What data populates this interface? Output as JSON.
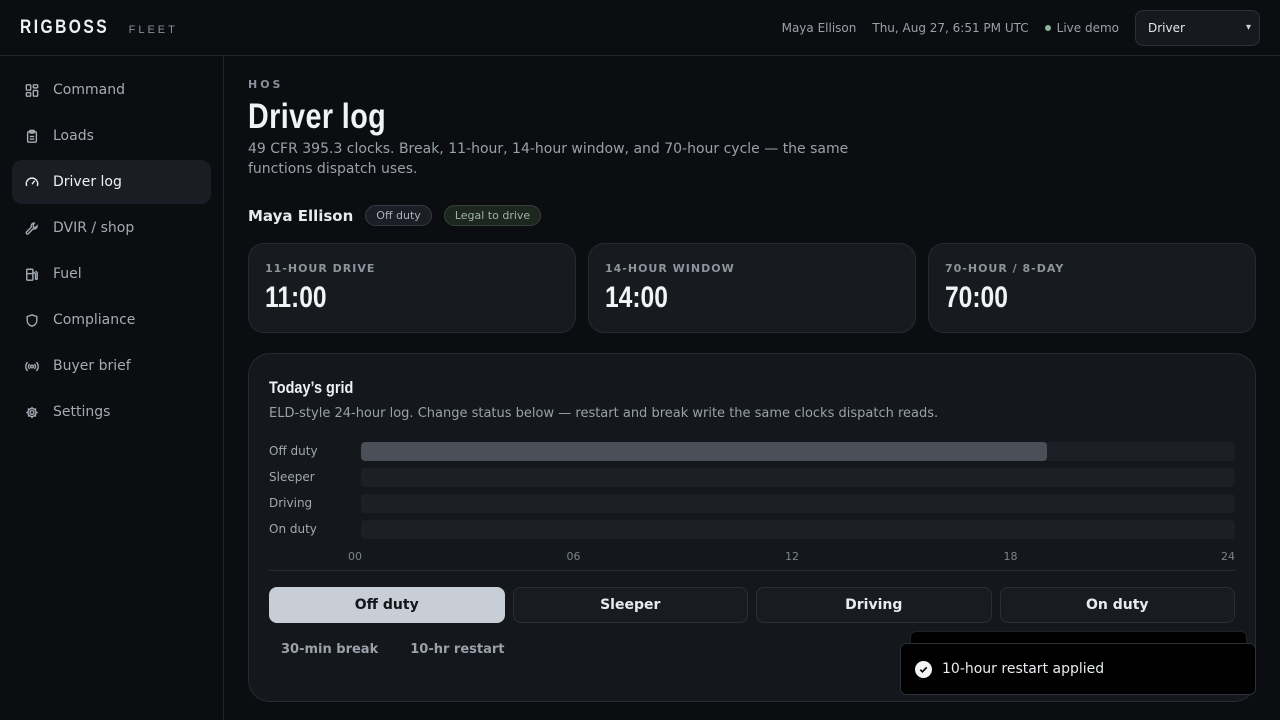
{
  "brand": {
    "name": "RIGBOSS",
    "sub": "FLEET"
  },
  "header": {
    "user": "Maya Ellison",
    "datetime": "Thu, Aug 27, 6:51 PM UTC",
    "live_label": "Live demo",
    "role_value": "Driver",
    "live_color": "#8fb39a"
  },
  "sidebar": {
    "items": [
      {
        "label": "Command",
        "icon": "dashboard-icon"
      },
      {
        "label": "Loads",
        "icon": "clipboard-icon"
      },
      {
        "label": "Driver log",
        "icon": "gauge-icon"
      },
      {
        "label": "DVIR / shop",
        "icon": "wrench-icon"
      },
      {
        "label": "Fuel",
        "icon": "fuel-pump-icon"
      },
      {
        "label": "Compliance",
        "icon": "shield-icon"
      },
      {
        "label": "Buyer brief",
        "icon": "broadcast-icon"
      },
      {
        "label": "Settings",
        "icon": "gear-icon"
      }
    ],
    "active_index": 2
  },
  "page": {
    "eyebrow": "HOS",
    "title": "Driver log",
    "description": "49 CFR 395.3 clocks. Break, 11-hour, 14-hour window, and 70-hour cycle — the same functions dispatch uses."
  },
  "driver": {
    "name": "Maya Ellison",
    "status_badge": "Off duty",
    "legal_badge": "Legal to drive"
  },
  "clocks": [
    {
      "label": "11-HOUR DRIVE",
      "value": "11:00"
    },
    {
      "label": "14-HOUR WINDOW",
      "value": "14:00"
    },
    {
      "label": "70-HOUR / 8-DAY",
      "value": "70:00"
    }
  ],
  "grid": {
    "title": "Today’s grid",
    "description": "ELD-style 24-hour log. Change status below — restart and break write the same clocks dispatch reads.",
    "rows": [
      {
        "label": "Off duty",
        "fill_fraction": 0.785
      },
      {
        "label": "Sleeper",
        "fill_fraction": 0
      },
      {
        "label": "Driving",
        "fill_fraction": 0
      },
      {
        "label": "On duty",
        "fill_fraction": 0
      }
    ],
    "ticks": [
      "00",
      "06",
      "12",
      "18",
      "24"
    ],
    "fill_color": "#4b5058"
  },
  "status_buttons": [
    "Off duty",
    "Sleeper",
    "Driving",
    "On duty"
  ],
  "active_status": 0,
  "actions": {
    "break": "30-min break",
    "restart": "10-hr restart"
  },
  "toast": {
    "message": "10-hour restart applied"
  }
}
